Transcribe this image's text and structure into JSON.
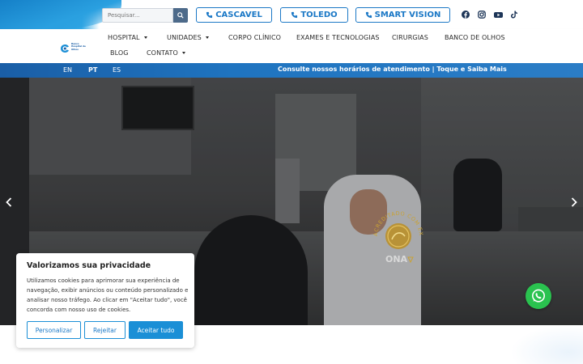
{
  "search": {
    "placeholder": "Pesquisar..."
  },
  "top_buttons": [
    {
      "label": "CASCAVEL"
    },
    {
      "label": "TOLEDO"
    },
    {
      "label": "SMART VISION"
    }
  ],
  "social": [
    "facebook-icon",
    "instagram-icon",
    "youtube-icon",
    "tiktok-icon"
  ],
  "logo": {
    "text": "Banco Hospital de Olhos"
  },
  "nav": [
    {
      "label": "HOSPITAL",
      "dropdown": true
    },
    {
      "label": "UNIDADES",
      "dropdown": true
    },
    {
      "label": "CORPO CLÍNICO",
      "dropdown": false
    },
    {
      "label": "EXAMES E TECNOLOGIAS",
      "dropdown": false
    },
    {
      "label": "CIRURGIAS",
      "dropdown": false
    },
    {
      "label": "BANCO DE OLHOS",
      "dropdown": false
    },
    {
      "label": "BLOG",
      "dropdown": false
    },
    {
      "label": "CONTATO",
      "dropdown": true
    }
  ],
  "languages": [
    {
      "label": "EN",
      "active": false
    },
    {
      "label": "PT",
      "active": true
    },
    {
      "label": "ES",
      "active": false
    }
  ],
  "info_banner": "Consulte nossos horários de atendimento | Toque e Saiba Mais",
  "badge": {
    "text": "ACREDITADO COM EXCELÊNCIA",
    "brand": "ONA"
  },
  "cookie": {
    "title": "Valorizamos sua privacidade",
    "body": "Utilizamos cookies para aprimorar sua experiência de navegação, exibir anúncios ou conteúdo personalizado e analisar nosso tráfego. Ao clicar em \"Aceitar tudo\", você concorda com nosso uso de cookies.",
    "customize": "Personalizar",
    "reject": "Rejeitar",
    "accept": "Aceitar tudo"
  },
  "colors": {
    "brand_blue": "#1b78c6",
    "info_bar": "#1f74c0",
    "whatsapp": "#2ac24f",
    "gold": "#c9a235"
  }
}
